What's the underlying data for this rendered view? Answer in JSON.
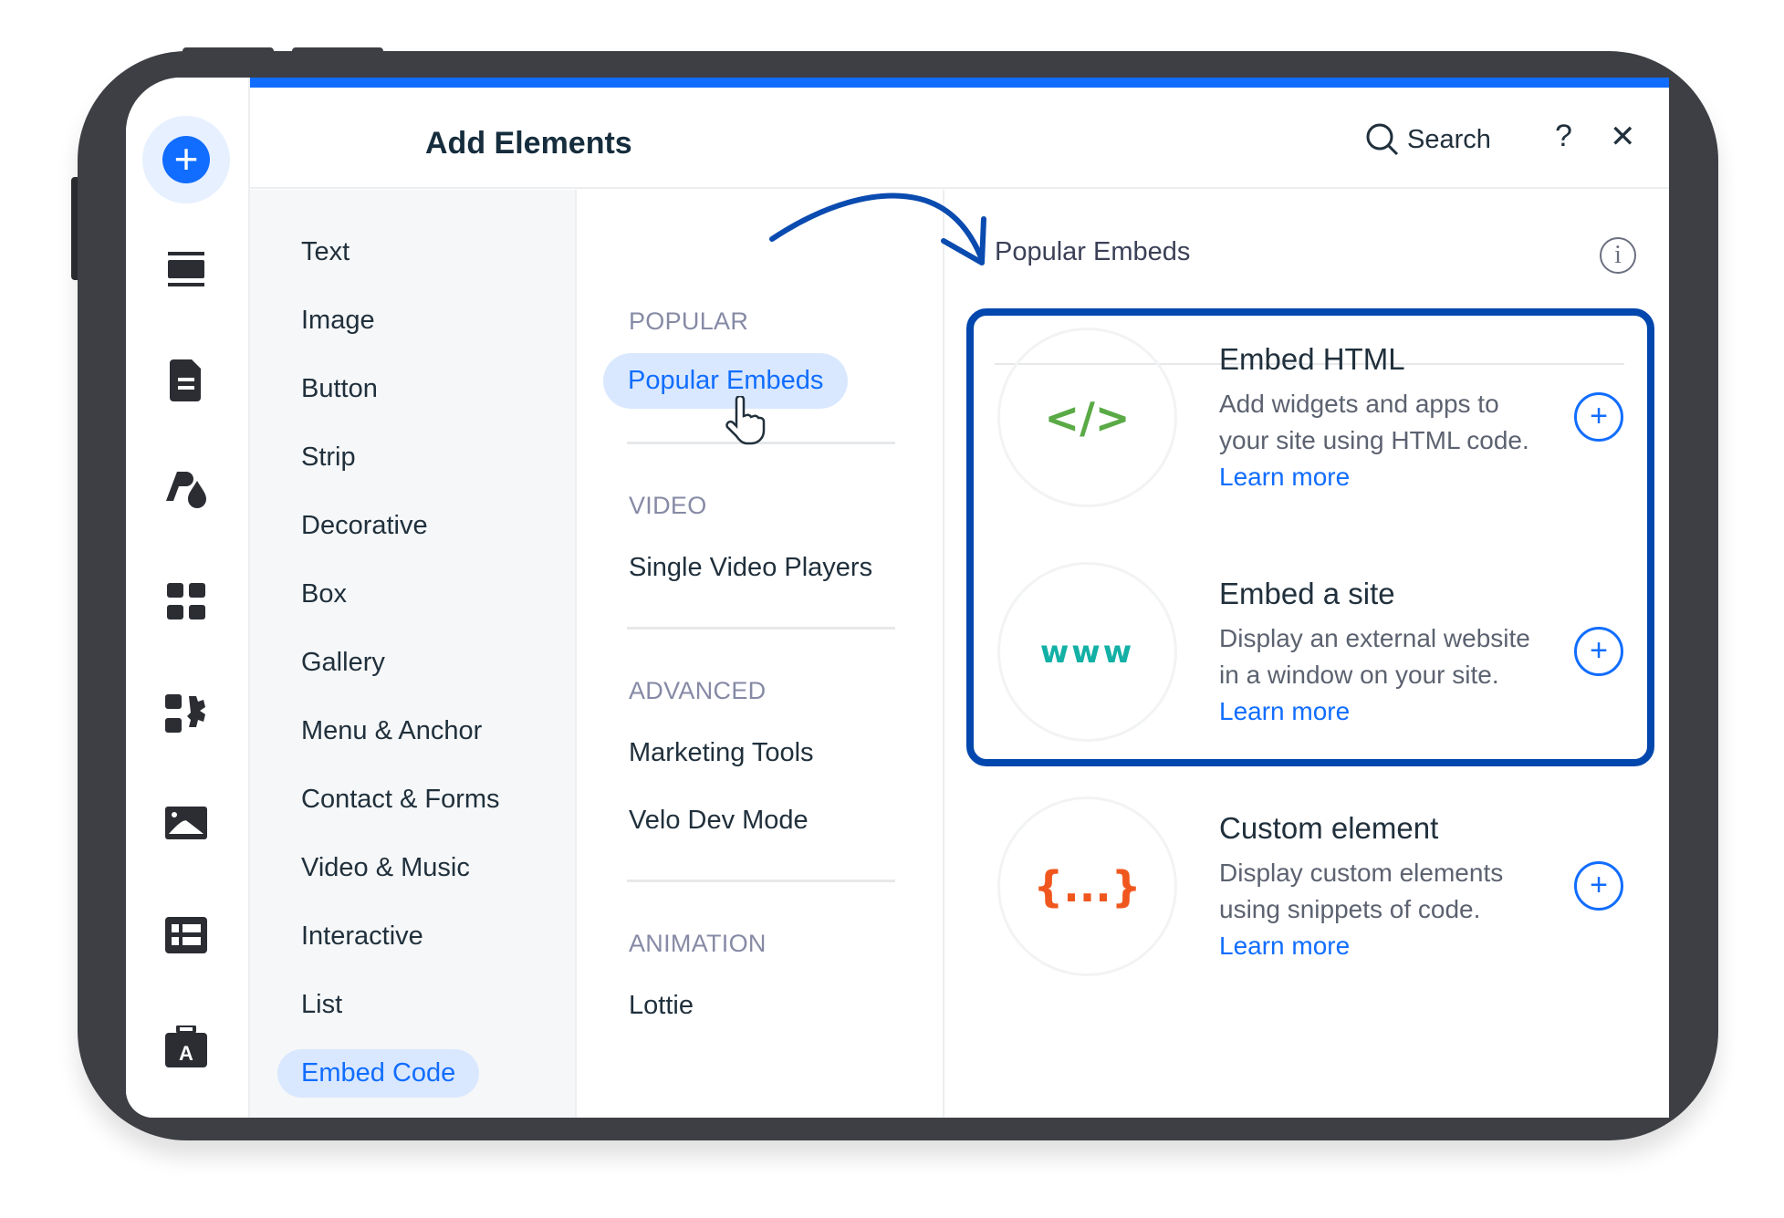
{
  "header": {
    "title": "Add Elements",
    "search_label": "Search",
    "help_label": "?",
    "close_label": "✕"
  },
  "rail": {
    "icons": [
      "add-icon",
      "strip-icon",
      "page-icon",
      "theme-icon",
      "apps-icon",
      "business-icon",
      "media-icon",
      "cms-icon",
      "portfolio-icon"
    ]
  },
  "categories": [
    "Text",
    "Image",
    "Button",
    "Strip",
    "Decorative",
    "Box",
    "Gallery",
    "Menu & Anchor",
    "Contact & Forms",
    "Video & Music",
    "Interactive",
    "List",
    "Embed Code"
  ],
  "selected_category": "Embed Code",
  "subcategories": [
    {
      "section": "POPULAR",
      "items": [
        "Popular Embeds"
      ]
    },
    {
      "section": "VIDEO",
      "items": [
        "Single Video Players"
      ]
    },
    {
      "section": "ADVANCED",
      "items": [
        "Marketing Tools",
        "Velo Dev Mode"
      ]
    },
    {
      "section": "ANIMATION",
      "items": [
        "Lottie"
      ]
    }
  ],
  "panel": {
    "title": "Popular Embeds",
    "info_icon": "i"
  },
  "cards": [
    {
      "icon": "</>",
      "icon_color": "#5aaa46",
      "title": "Embed HTML",
      "desc": "Add widgets and apps to your site using HTML code.",
      "link": "Learn more"
    },
    {
      "icon": "www",
      "icon_color": "#12b0a5",
      "title": "Embed a site",
      "desc": "Display an external website in a window on your site.",
      "link": "Learn more"
    },
    {
      "icon": "{...}",
      "icon_color": "#f0571e",
      "title": "Custom element",
      "desc": "Display custom elements using snippets of code.",
      "link": "Learn more"
    }
  ],
  "colors": {
    "accent": "#116dff",
    "highlight": "#0147ad",
    "frame": "#3d3f44"
  }
}
